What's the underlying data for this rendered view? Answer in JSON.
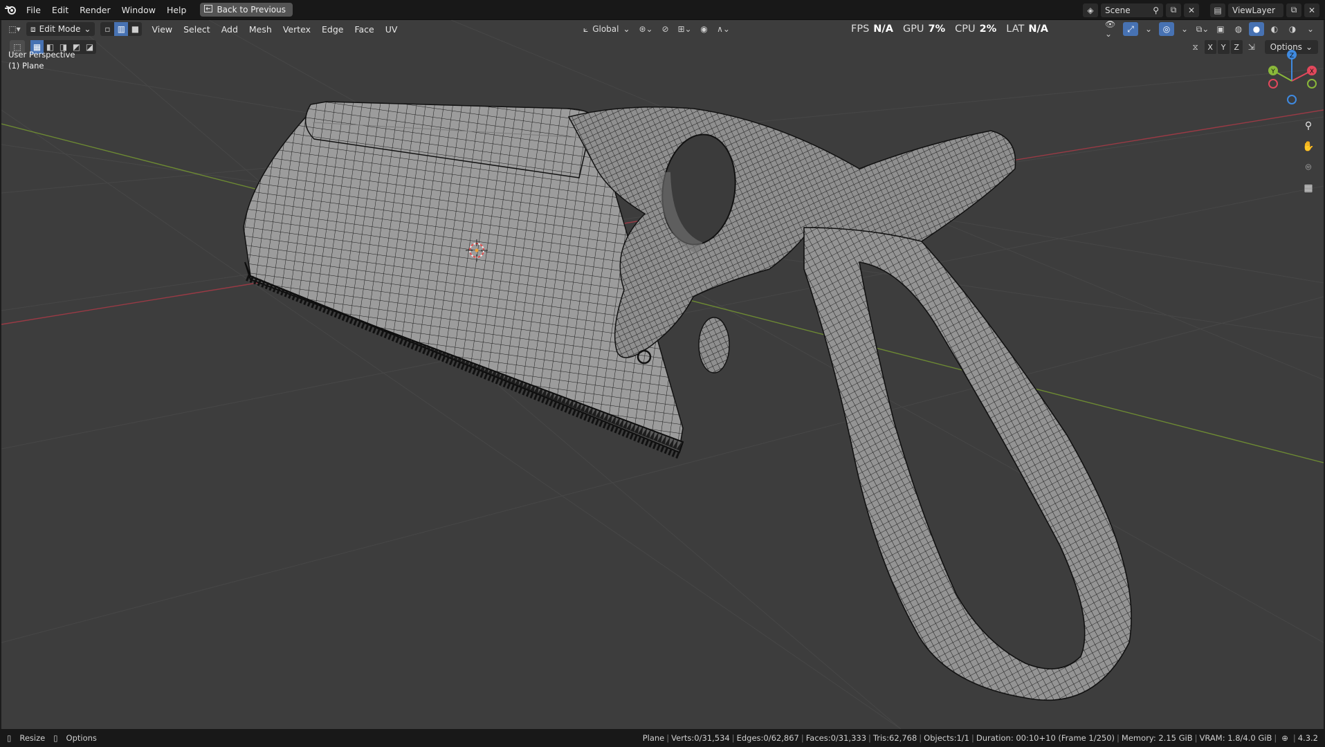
{
  "topbar": {
    "menus": [
      "File",
      "Edit",
      "Render",
      "Window",
      "Help"
    ],
    "back_label": "Back to Previous",
    "scene_value": "Scene",
    "viewlayer_value": "ViewLayer"
  },
  "viewport_header": {
    "mode": "Edit Mode",
    "menus": [
      "View",
      "Select",
      "Add",
      "Mesh",
      "Vertex",
      "Edge",
      "Face",
      "UV"
    ],
    "transform_orientation": "Global",
    "stats": {
      "fps_label": "FPS",
      "fps_value": "N/A",
      "gpu_label": "GPU",
      "gpu_value": "7%",
      "cpu_label": "CPU",
      "cpu_value": "2%",
      "lat_label": "LAT",
      "lat_value": "N/A"
    },
    "options_label": "Options",
    "axes": [
      "X",
      "Y",
      "Z"
    ]
  },
  "overlay": {
    "view_name": "User Perspective",
    "object_name": "(1) Plane"
  },
  "gizmo": {
    "x": "X",
    "y": "Y",
    "z": "Z"
  },
  "statusbar": {
    "left": [
      {
        "label": "Resize"
      },
      {
        "label": "Options"
      }
    ],
    "object": "Plane",
    "verts": "Verts:0/31,534",
    "edges": "Edges:0/62,867",
    "faces": "Faces:0/31,333",
    "tris": "Tris:62,768",
    "objects": "Objects:1/1",
    "duration": "Duration: 00:10+10 (Frame 1/250)",
    "memory": "Memory: 2.15 GiB",
    "vram": "VRAM: 1.8/4.0 GiB",
    "version": "4.3.2"
  },
  "colors": {
    "accent": "#4772b3",
    "viewport_bg": "#3d3d3d",
    "axis_x": "#e3485c",
    "axis_y": "#8ab83a",
    "axis_z": "#3f8ae0",
    "mesh_fill": "#9a9a9a",
    "wire": "#141414"
  }
}
